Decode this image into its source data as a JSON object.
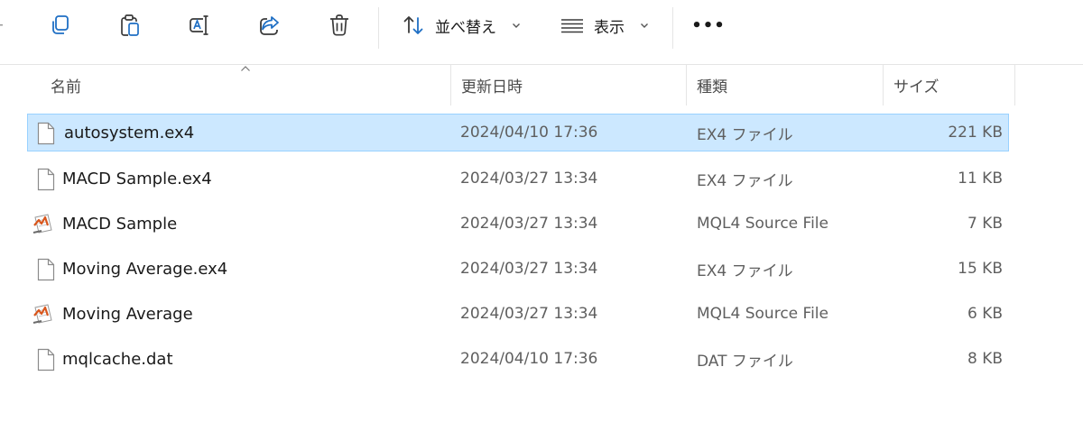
{
  "toolbar": {
    "copy_icon": "copy-icon",
    "paste_icon": "paste-icon",
    "rename_icon": "rename-icon",
    "share_icon": "share-icon",
    "delete_icon": "trash-icon",
    "sort_label": "並べ替え",
    "view_label": "表示",
    "more_label": "•••"
  },
  "columns": {
    "name": "名前",
    "modified": "更新日時",
    "type": "種類",
    "size": "サイズ"
  },
  "files": [
    {
      "name": "autosystem.ex4",
      "modified": "2024/04/10 17:36",
      "type": "EX4 ファイル",
      "size": "221 KB",
      "icon": "blank-file-icon",
      "selected": true
    },
    {
      "name": "MACD Sample.ex4",
      "modified": "2024/03/27 13:34",
      "type": "EX4 ファイル",
      "size": "11 KB",
      "icon": "blank-file-icon",
      "selected": false
    },
    {
      "name": "MACD Sample",
      "modified": "2024/03/27 13:34",
      "type": "MQL4 Source File",
      "size": "7 KB",
      "icon": "mql4-source-icon",
      "selected": false
    },
    {
      "name": "Moving Average.ex4",
      "modified": "2024/03/27 13:34",
      "type": "EX4 ファイル",
      "size": "15 KB",
      "icon": "blank-file-icon",
      "selected": false
    },
    {
      "name": "Moving Average",
      "modified": "2024/03/27 13:34",
      "type": "MQL4 Source File",
      "size": "6 KB",
      "icon": "mql4-source-icon",
      "selected": false
    },
    {
      "name": "mqlcache.dat",
      "modified": "2024/04/10 17:36",
      "type": "DAT ファイル",
      "size": "8 KB",
      "icon": "blank-file-icon",
      "selected": false
    }
  ],
  "colors": {
    "accent": "#0067c0",
    "selection_bg": "#cce8ff",
    "selection_border": "#99d1ff"
  }
}
